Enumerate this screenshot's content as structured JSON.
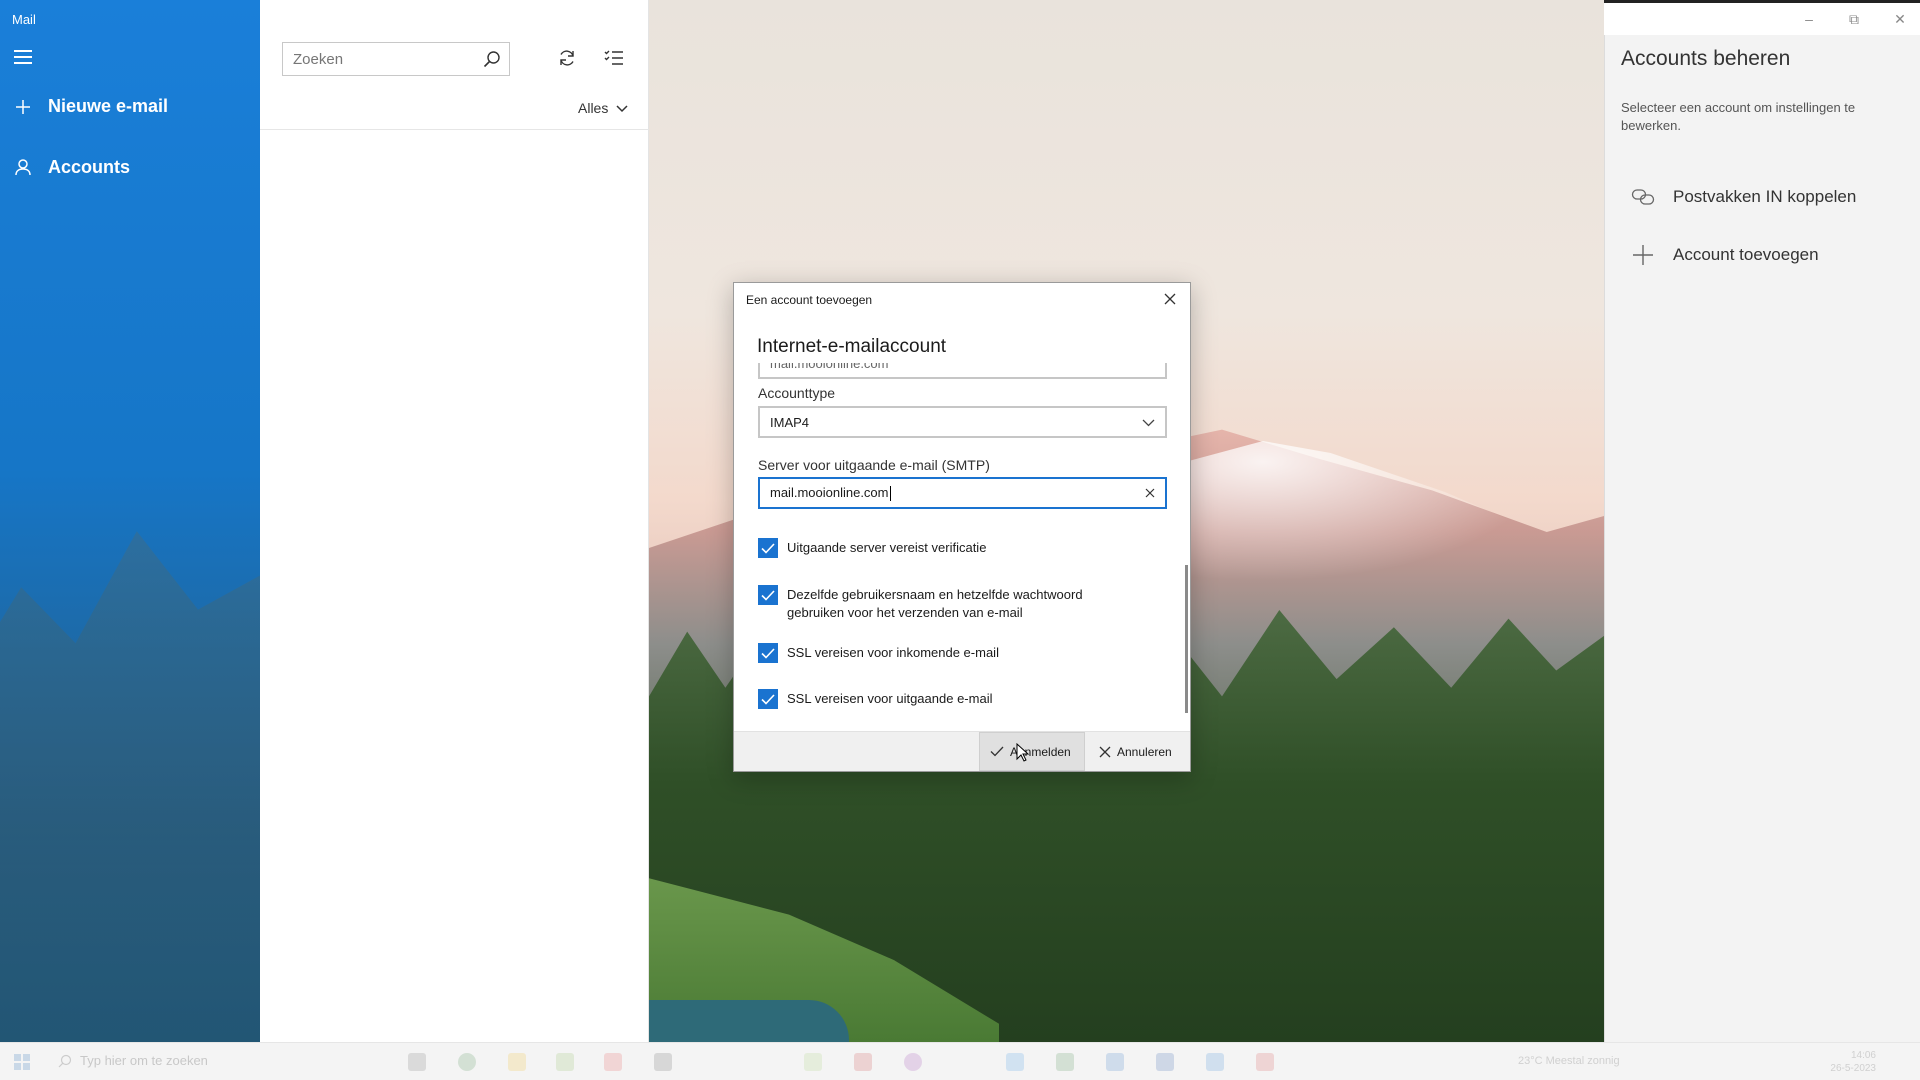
{
  "window": {
    "app_title": "Mail",
    "controls": {
      "minimize": "–",
      "maximize": "⧉",
      "close": "✕"
    }
  },
  "nav": {
    "new_mail": "Nieuwe e-mail",
    "accounts": "Accounts"
  },
  "message_list": {
    "search_placeholder": "Zoeken",
    "filter_label": "Alles"
  },
  "accounts_panel": {
    "title": "Accounts beheren",
    "subtitle": "Selecteer een account om instellingen te bewerken.",
    "link_inboxes": "Postvakken IN koppelen",
    "add_account": "Account toevoegen"
  },
  "dialog": {
    "title": "Een account toevoegen",
    "heading": "Internet-e-mailaccount",
    "previous_field_value": "mail.mooionline.com",
    "account_type_label": "Accounttype",
    "account_type_value": "IMAP4",
    "smtp_label": "Server voor uitgaande e-mail (SMTP)",
    "smtp_value": "mail.mooionline.com",
    "checkboxes": [
      {
        "label": "Uitgaande server vereist verificatie",
        "checked": true
      },
      {
        "label": "Dezelfde gebruikersnaam en hetzelfde wachtwoord gebruiken voor het verzenden van e-mail",
        "checked": true
      },
      {
        "label": "SSL vereisen voor inkomende e-mail",
        "checked": true
      },
      {
        "label": "SSL vereisen voor uitgaande e-mail",
        "checked": true
      }
    ],
    "sign_in_button": "Aanmelden",
    "cancel_button": "Annuleren"
  },
  "taskbar": {
    "search_placeholder": "Typ hier om te zoeken",
    "tray_text": "23°C  Meestal zonnig",
    "clock_time": "14:06",
    "clock_date": "26-5-2023"
  },
  "colors": {
    "nav_blue": "#1a7fd9",
    "accent": "#1a73d0",
    "panel_bg": "#f3f3f3"
  },
  "icons": {
    "hamburger": "hamburger-icon",
    "new_mail": "plus-icon",
    "accounts": "person-icon",
    "search": "search-icon",
    "sync": "sync-icon",
    "filter": "filter-list-icon",
    "link": "link-icon",
    "add": "plus-icon",
    "close": "close-icon",
    "check": "checkmark-icon"
  }
}
